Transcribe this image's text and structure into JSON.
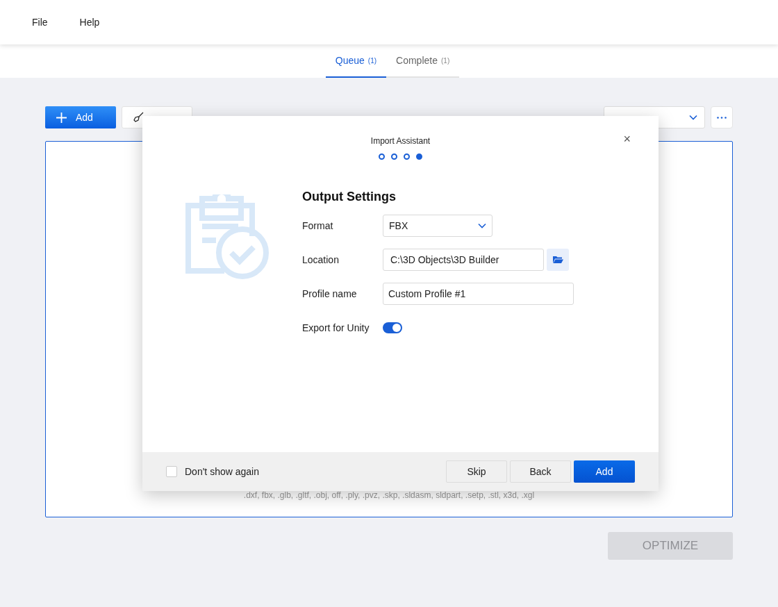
{
  "menu": [
    "File",
    "Help"
  ],
  "tabs": [
    {
      "label": "Queue",
      "count": "(1)",
      "selected": true
    },
    {
      "label": "Complete",
      "count": "(1)",
      "selected": false
    }
  ],
  "toolbar": {
    "add_label": "Add"
  },
  "dropzone": {
    "formats": ".dxf, fbx, .glb, .gltf, .obj, off, .ply, .pvz, .skp, .sldasm, sldpart, .setp, .stl, x3d, .xgl"
  },
  "optimize": {
    "label": "OPTIMIZE",
    "disabled": true
  },
  "dialog": {
    "title": "Import Assistant",
    "close": "×",
    "steps": [
      {
        "selected": false
      },
      {
        "selected": false
      },
      {
        "selected": false
      },
      {
        "selected": true
      }
    ],
    "heading": "Output Settings",
    "fields": [
      {
        "kind": "select",
        "label": "Format",
        "value": "FBX"
      },
      {
        "kind": "path",
        "label": "Location",
        "value": "C:\\3D Objects\\3D Builder"
      },
      {
        "kind": "text",
        "label": "Profile name",
        "value": "Custom Profile #1"
      },
      {
        "kind": "toggle",
        "label": "Export for Unity",
        "on": true
      }
    ],
    "dont_show": {
      "label": "Don't show again",
      "checked": false
    },
    "buttons": [
      {
        "label": "Skip",
        "primary": false
      },
      {
        "label": "Back",
        "primary": false
      },
      {
        "label": "Add",
        "primary": true
      }
    ]
  }
}
